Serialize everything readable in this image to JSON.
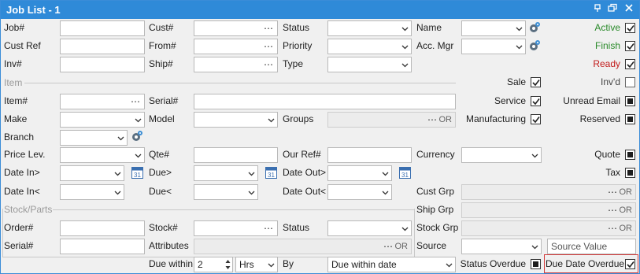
{
  "window": {
    "title": "Job List - 1",
    "pin": "⚀",
    "restore": "⧉",
    "close": "✕"
  },
  "fields": {
    "job": "Job#",
    "cust": "Cust#",
    "status": "Status",
    "name": "Name",
    "custref": "Cust Ref",
    "from": "From#",
    "priority": "Priority",
    "accmgr": "Acc. Mgr",
    "inv": "Inv#",
    "ship": "Ship#",
    "type": "Type",
    "item_section": "Item",
    "item": "Item#",
    "serial": "Serial#",
    "make": "Make",
    "model": "Model",
    "groups": "Groups",
    "branch": "Branch",
    "pricelev": "Price Lev.",
    "qte": "Qte#",
    "ourref": "Our Ref#",
    "currency": "Currency",
    "datein_gt": "Date In>",
    "due_gt": "Due>",
    "dateout_gt": "Date Out>",
    "datein_lt": "Date In<",
    "due_lt": "Due<",
    "dateout_lt": "Date Out<",
    "custgrp": "Cust Grp",
    "stock_section": "Stock/Parts",
    "shipgrp": "Ship Grp",
    "order": "Order#",
    "stock": "Stock#",
    "status2": "Status",
    "stockgrp": "Stock Grp",
    "serial2": "Serial#",
    "attributes": "Attributes",
    "source": "Source",
    "duewithin": "Due within",
    "by": "By"
  },
  "values": {
    "due_within": "2",
    "hrs": "Hrs",
    "by_value": "Due within date",
    "source_placeholder": "Source Value",
    "or": "OR",
    "dots": "⋯",
    "cal_day": "31"
  },
  "checks": {
    "active": {
      "label": "Active",
      "checked": true
    },
    "finish": {
      "label": "Finish",
      "checked": true
    },
    "ready": {
      "label": "Ready",
      "checked": true
    },
    "sale": {
      "label": "Sale",
      "checked": true
    },
    "invd": {
      "label": "Inv'd",
      "checked": false
    },
    "service": {
      "label": "Service",
      "checked": true
    },
    "unread": {
      "label": "Unread Email",
      "checked": "indeterminate"
    },
    "manufacturing": {
      "label": "Manufacturing",
      "checked": true
    },
    "reserved": {
      "label": "Reserved",
      "checked": "indeterminate"
    },
    "quote": {
      "label": "Quote",
      "checked": "indeterminate"
    },
    "tax": {
      "label": "Tax",
      "checked": "indeterminate"
    },
    "statusoverdue": {
      "label": "Status Overdue",
      "checked": "indeterminate"
    },
    "duedateoverdue": {
      "label": "Due Date Overdue",
      "checked": true
    }
  },
  "colors": {
    "titlebar": "#2f8ad8",
    "green": "#2a8a2a",
    "red": "#c21c1c",
    "highlight": "#d23a3a"
  }
}
